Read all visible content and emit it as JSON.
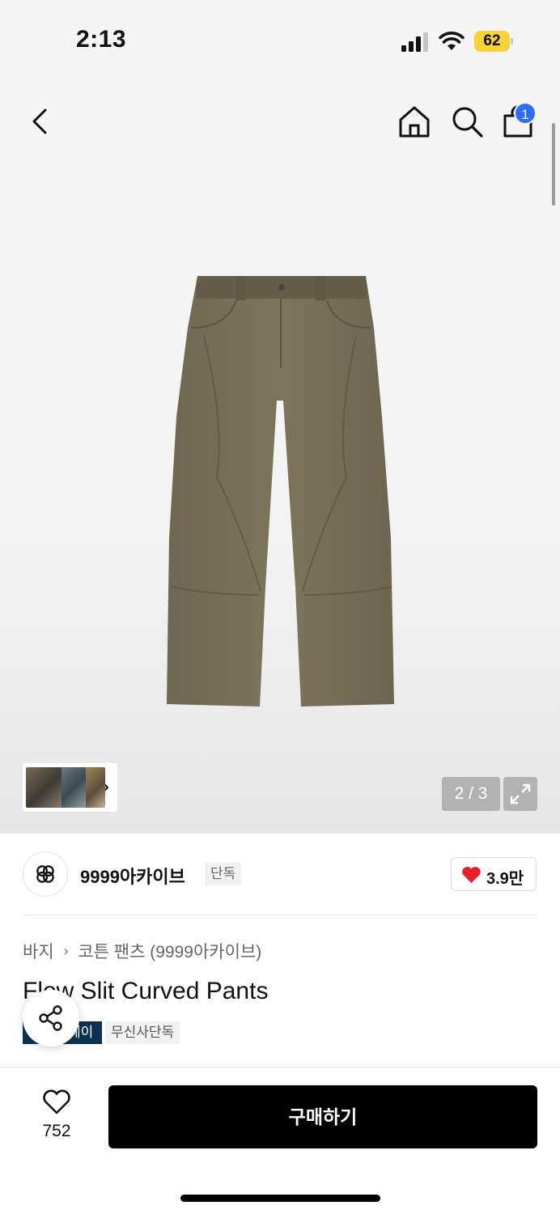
{
  "status_bar": {
    "time": "2:13",
    "battery": "62"
  },
  "header": {
    "icons": [
      "chevron-left-icon",
      "home-icon",
      "search-icon",
      "shopping-bag-icon"
    ],
    "cart_badge": "1"
  },
  "gallery": {
    "page_counter": "2 / 3",
    "thumbnails_count": 3
  },
  "brand": {
    "name": "9999아카이브",
    "tag": "단독",
    "likes": "3.9만"
  },
  "product": {
    "breadcrumb": [
      "바지",
      "코튼 팬츠 (9999아카이브)"
    ],
    "title": "Flow Slit Curved Pants",
    "badges": [
      "페이",
      "무신사단독"
    ]
  },
  "bottom_bar": {
    "wish_count": "752",
    "buy_label": "구매하기"
  },
  "colors": {
    "buy_button": "#000000",
    "cart_badge": "#2f6df6",
    "battery": "#f7d23a",
    "badge_dark": "#0c3052",
    "heart": "#e8202a",
    "pants": "#7a7159"
  }
}
